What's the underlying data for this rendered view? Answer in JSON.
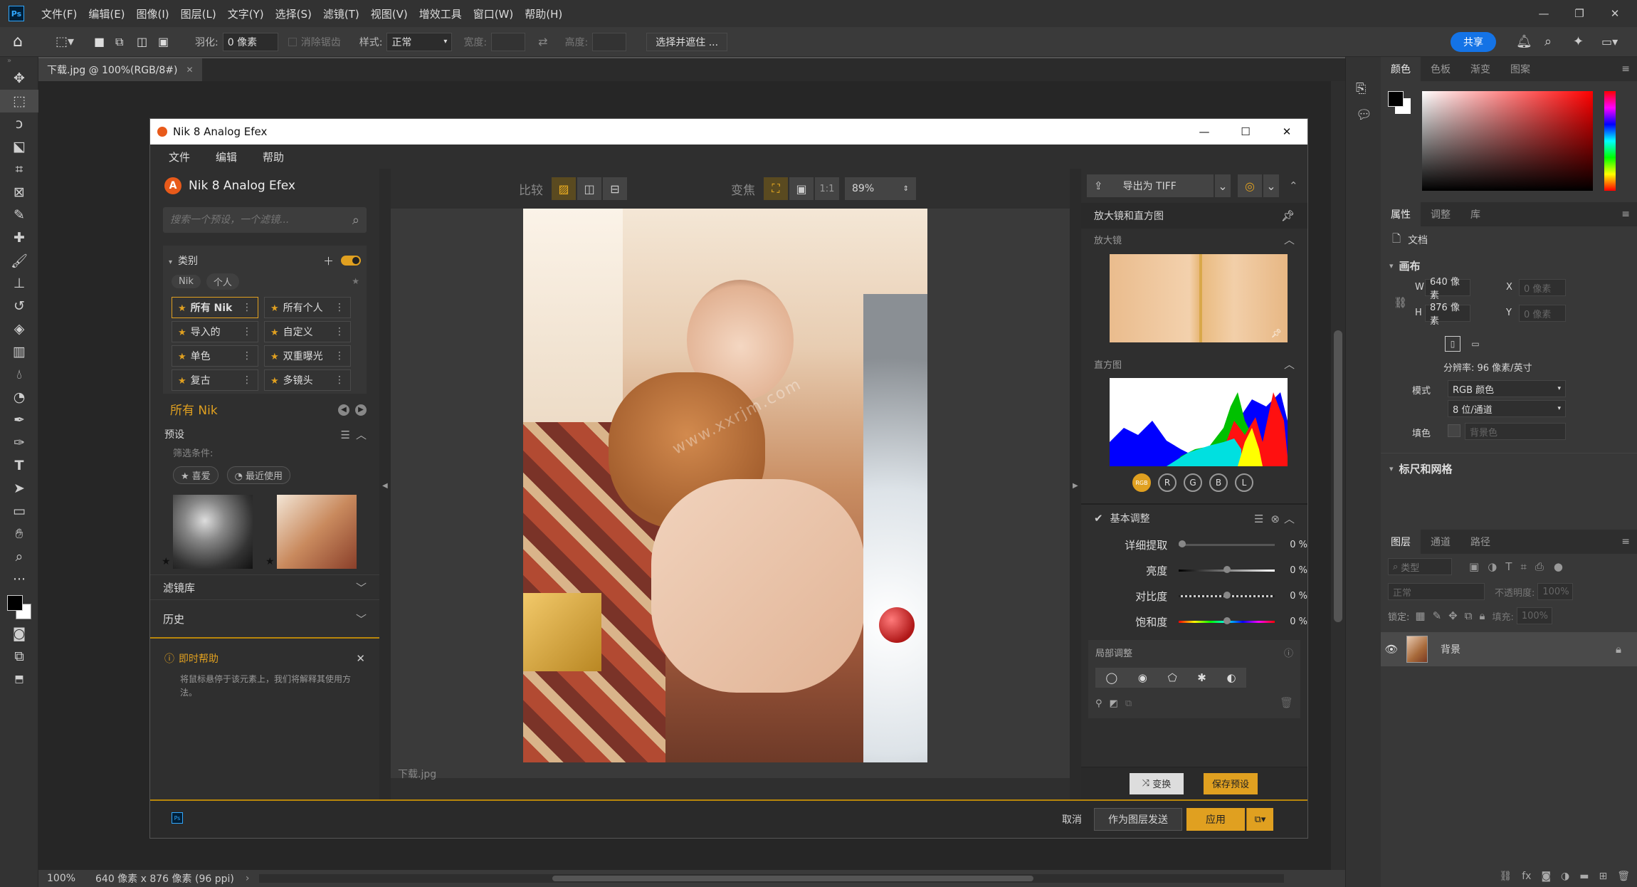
{
  "menu": {
    "items": [
      "文件(F)",
      "编辑(E)",
      "图像(I)",
      "图层(L)",
      "文字(Y)",
      "选择(S)",
      "滤镜(T)",
      "视图(V)",
      "增效工具",
      "窗口(W)",
      "帮助(H)"
    ],
    "share": "共享"
  },
  "options": {
    "feather_label": "羽化:",
    "feather_value": "0 像素",
    "antialias_label": "消除锯齿",
    "style_label": "样式:",
    "style_value": "正常",
    "width_label": "宽度:",
    "height_label": "高度:",
    "select_mask_btn": "选择并遮住 ..."
  },
  "document": {
    "tab_title": "下载.jpg @ 100%(RGB/8#)"
  },
  "status": {
    "zoom": "100%",
    "dimensions": "640 像素 x 876 像素 (96 ppi)"
  },
  "nik": {
    "window_title": "Nik 8 Analog Efex",
    "menu": [
      "文件",
      "编辑",
      "帮助"
    ],
    "brand": "Nik 8 Analog Efex",
    "search_placeholder": "搜索一个预设，一个滤镜...",
    "categories_label": "类别",
    "cat_tags": [
      "Nik",
      "个人"
    ],
    "filters": [
      {
        "label": "所有 Nik",
        "selected": true
      },
      {
        "label": "所有个人",
        "selected": false
      },
      {
        "label": "导入的",
        "selected": false
      },
      {
        "label": "自定义",
        "selected": false
      },
      {
        "label": "单色",
        "selected": false
      },
      {
        "label": "双重曝光",
        "selected": false
      },
      {
        "label": "复古",
        "selected": false
      },
      {
        "label": "多镜头",
        "selected": false
      }
    ],
    "current_group": "所有 Nik",
    "presets_label": "预设",
    "filter_conditions": "筛选条件:",
    "fav_tag": "喜爱",
    "recent_tag": "最近使用",
    "filter_lib": "滤镜库",
    "history": "历史",
    "help_title": "即时帮助",
    "help_text": "将鼠标悬停于该元素上，我们将解释其使用方法。",
    "compare_label": "比较",
    "zoom_label": "变焦",
    "one_to_one": "1:1",
    "zoom_value": "89%",
    "filename": "下载.jpg",
    "export_label": "导出为 TIFF",
    "loupe_hist_title": "放大镜和直方图",
    "loupe_label": "放大镜",
    "histogram_label": "直方图",
    "channels": [
      "RGB",
      "R",
      "G",
      "B",
      "L"
    ],
    "basic_adjust": "基本调整",
    "sliders": [
      {
        "label": "详细提取",
        "value": "0 %",
        "pos": 0.0
      },
      {
        "label": "亮度",
        "value": "0 %",
        "pos": 0.5
      },
      {
        "label": "对比度",
        "value": "0 %",
        "pos": 0.5
      },
      {
        "label": "饱和度",
        "value": "0 %",
        "pos": 0.5
      }
    ],
    "local_adjust": "局部调整",
    "swap_btn": "变换",
    "save_preset_btn": "保存预设",
    "cancel_btn": "取消",
    "send_as_layer_btn": "作为图层发送",
    "apply_btn": "应用",
    "watermark": "www.xxrjm.com"
  },
  "panels": {
    "color_tabs": [
      "颜色",
      "色板",
      "渐变",
      "图案"
    ],
    "prop_tabs": [
      "属性",
      "调整",
      "库"
    ],
    "doc_label": "文档",
    "canvas_label": "画布",
    "w_label": "W",
    "w_value": "640 像素",
    "h_label": "H",
    "h_value": "876 像素",
    "x_label": "X",
    "x_value": "0 像素",
    "y_label": "Y",
    "y_value": "0 像素",
    "resolution": "分辨率: 96 像素/英寸",
    "mode_label": "模式",
    "mode_value": "RGB 颜色",
    "depth_value": "8 位/通道",
    "fill_label": "填色",
    "fill_value": "背景色",
    "rulers_label": "标尺和网格",
    "layer_tabs": [
      "图层",
      "通道",
      "路径"
    ],
    "kind_value": "类型",
    "blend_value": "正常",
    "opacity_label": "不透明度:",
    "opacity_value": "100%",
    "lock_label": "锁定:",
    "fill2_label": "填充:",
    "fill2_value": "100%",
    "layer_name": "背景"
  },
  "colors": {
    "accent": "#e0a020",
    "ps_blue": "#1473e6",
    "hist_bg": "#ffffff"
  }
}
